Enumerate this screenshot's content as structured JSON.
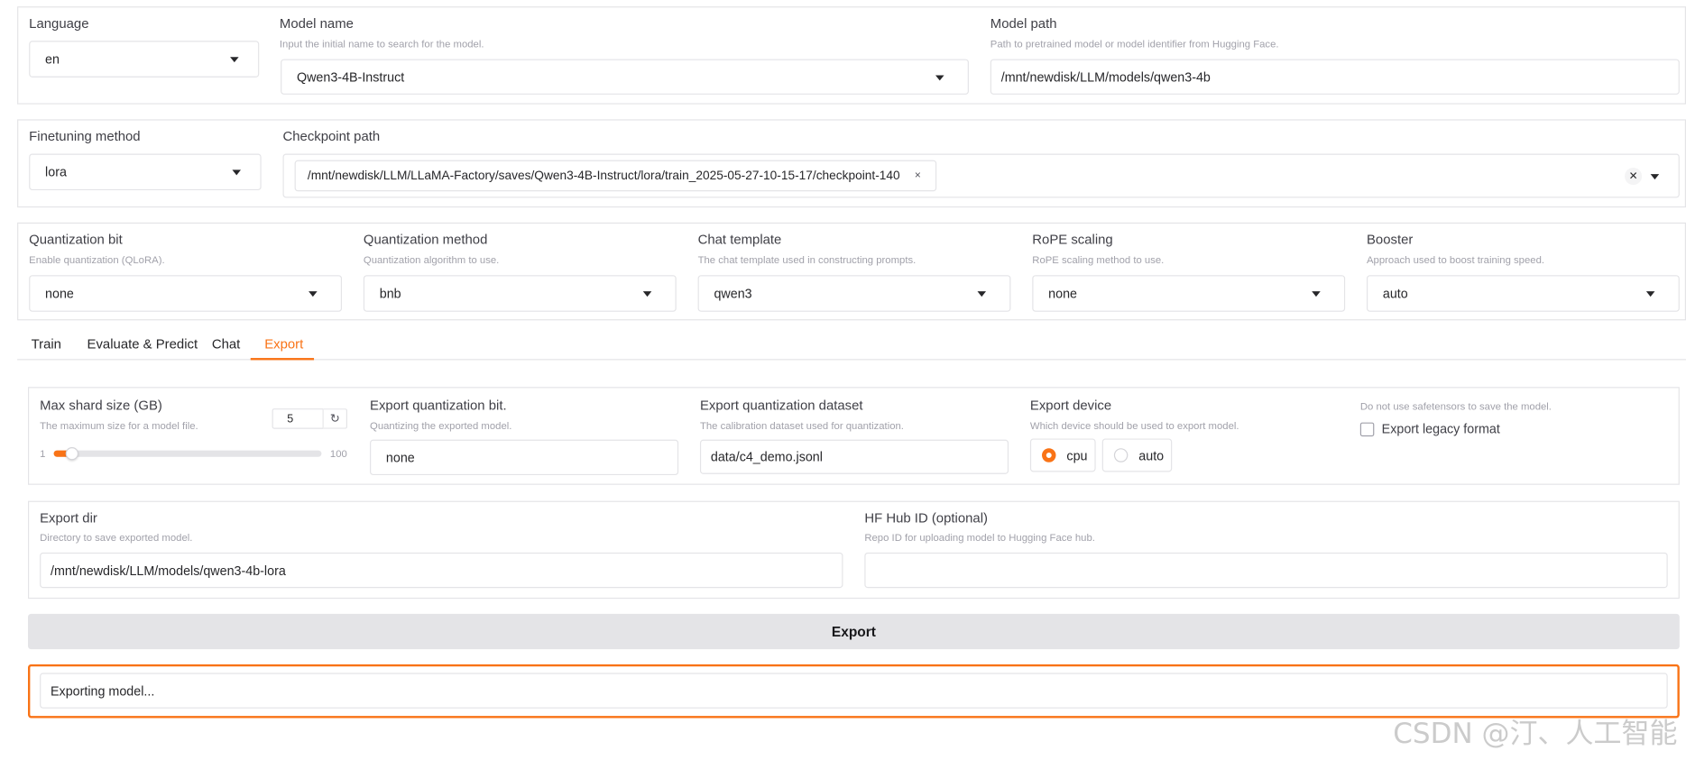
{
  "colors": {
    "accent": "#f97316",
    "border": "#e4e4e7",
    "muted": "#a1a1aa",
    "button_bg": "#e4e4e7"
  },
  "model": {
    "language": {
      "label": "Language",
      "value": "en"
    },
    "model_name": {
      "label": "Model name",
      "info": "Input the initial name to search for the model.",
      "value": "Qwen3-4B-Instruct"
    },
    "model_path": {
      "label": "Model path",
      "info": "Path to pretrained model or model identifier from Hugging Face.",
      "value": "/mnt/newdisk/LLM/models/qwen3-4b"
    }
  },
  "finetune": {
    "method": {
      "label": "Finetuning method",
      "value": "lora"
    },
    "checkpoint": {
      "label": "Checkpoint path",
      "chip": "/mnt/newdisk/LLM/LLaMA-Factory/saves/Qwen3-4B-Instruct/lora/train_2025-05-27-10-15-17/checkpoint-140",
      "chip_remove": "×",
      "clear": "✕"
    }
  },
  "advanced": [
    {
      "label": "Quantization bit",
      "info": "Enable quantization (QLoRA).",
      "value": "none"
    },
    {
      "label": "Quantization method",
      "info": "Quantization algorithm to use.",
      "value": "bnb"
    },
    {
      "label": "Chat template",
      "info": "The chat template used in constructing prompts.",
      "value": "qwen3"
    },
    {
      "label": "RoPE scaling",
      "info": "RoPE scaling method to use.",
      "value": "none"
    },
    {
      "label": "Booster",
      "info": "Approach used to boost training speed.",
      "value": "auto"
    }
  ],
  "tabs": [
    {
      "label": "Train"
    },
    {
      "label": "Evaluate & Predict"
    },
    {
      "label": "Chat"
    },
    {
      "label": "Export"
    }
  ],
  "active_tab": "Export",
  "export": {
    "shard": {
      "label": "Max shard size (GB)",
      "info": "The maximum size for a model file.",
      "value": "5",
      "min": "1",
      "max": "100",
      "level": 5,
      "range_min": 1,
      "range_max": 100,
      "reset_icon": "↻"
    },
    "quant_bit": {
      "label": "Export quantization bit.",
      "info": "Quantizing the exported model.",
      "value": "none"
    },
    "quant_dataset": {
      "label": "Export quantization dataset",
      "info": "The calibration dataset used for quantization.",
      "value": "data/c4_demo.jsonl"
    },
    "device": {
      "label": "Export device",
      "info": "Which device should be used to export model.",
      "options": [
        "cpu",
        "auto"
      ],
      "selected": "cpu"
    },
    "legacy": {
      "info": "Do not use safetensors to save the model.",
      "label": "Export legacy format",
      "checked": false
    },
    "dir": {
      "label": "Export dir",
      "info": "Directory to save exported model.",
      "value": "/mnt/newdisk/LLM/models/qwen3-4b-lora"
    },
    "hub": {
      "label": "HF Hub ID (optional)",
      "info": "Repo ID for uploading model to Hugging Face hub.",
      "value": ""
    },
    "button": "Export",
    "status": "Exporting model..."
  },
  "watermark": "CSDN @汀、人工智能"
}
